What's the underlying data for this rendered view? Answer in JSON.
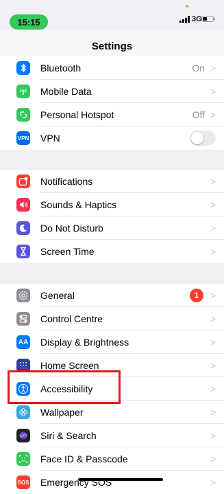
{
  "status_bar": {
    "time": "15:15",
    "network": "3G"
  },
  "nav": {
    "title": "Settings"
  },
  "groups": [
    {
      "rows": [
        {
          "label": "Bluetooth",
          "value": "On",
          "icon": "bluetooth-icon",
          "color": "#007aff"
        },
        {
          "label": "Mobile Data",
          "icon": "antenna-icon",
          "color": "#34c759"
        },
        {
          "label": "Personal Hotspot",
          "value": "Off",
          "icon": "hotspot-link-icon",
          "color": "#34c759"
        },
        {
          "label": "VPN",
          "icon_text": "VPN",
          "icon": "vpn-icon",
          "color": "#006ee6"
        }
      ]
    },
    {
      "rows": [
        {
          "label": "Notifications",
          "icon": "notifications-icon",
          "color": "#ff3b30"
        },
        {
          "label": "Sounds & Haptics",
          "icon": "speaker-icon",
          "color": "#ff2d55"
        },
        {
          "label": "Do Not Disturb",
          "icon": "moon-icon",
          "color": "#5856d6"
        },
        {
          "label": "Screen Time",
          "icon": "hourglass-icon",
          "color": "#5856d6"
        }
      ]
    },
    {
      "rows": [
        {
          "label": "General",
          "badge": "1",
          "icon": "gear-icon",
          "color": "#8e8e93"
        },
        {
          "label": "Control Centre",
          "icon": "toggles-icon",
          "color": "#8e8e93"
        },
        {
          "label": "Display & Brightness",
          "icon_text": "AA",
          "icon": "display-icon",
          "color": "#007aff"
        },
        {
          "label": "Home Screen",
          "icon": "home-grid-icon",
          "color": "#2c3e9e"
        },
        {
          "label": "Accessibility",
          "icon": "accessibility-icon",
          "color": "#007aff"
        },
        {
          "label": "Wallpaper",
          "icon": "flower-icon",
          "color": "#35a7e0"
        },
        {
          "label": "Siri & Search",
          "icon": "siri-icon",
          "color": "#222"
        },
        {
          "label": "Face ID & Passcode",
          "icon": "face-id-icon",
          "color": "#34c759"
        },
        {
          "label": "Emergency SOS",
          "icon_text": "SOS",
          "icon": "sos-icon",
          "color": "#ff3b30"
        }
      ]
    }
  ],
  "chevron": ">"
}
